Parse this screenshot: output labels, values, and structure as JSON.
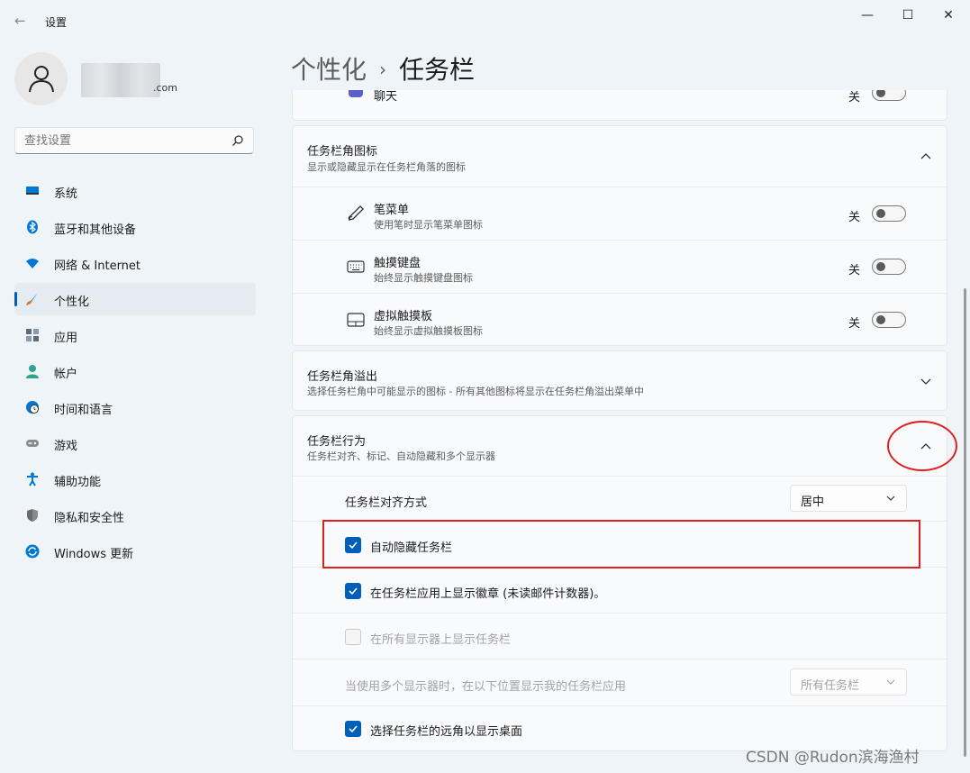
{
  "window": {
    "title": "设置",
    "back_icon": "arrow-left-icon",
    "minimize": "—",
    "maximize": "☐",
    "close": "✕"
  },
  "account": {
    "email_suffix": ".com",
    "avatar_icon": "person-icon"
  },
  "search": {
    "placeholder": "查找设置",
    "icon": "search-icon"
  },
  "nav": {
    "items": [
      {
        "label": "系统",
        "icon": "display-icon",
        "color": "#0078d4"
      },
      {
        "label": "蓝牙和其他设备",
        "icon": "bluetooth-icon",
        "color": "#0078d4"
      },
      {
        "label": "网络 & Internet",
        "icon": "wifi-icon",
        "color": "#0078d4"
      },
      {
        "label": "个性化",
        "icon": "brush-icon",
        "color": "#d07a2c",
        "active": true
      },
      {
        "label": "应用",
        "icon": "apps-icon",
        "color": "#5a6b7b"
      },
      {
        "label": "帐户",
        "icon": "account-icon",
        "color": "#2ca58d"
      },
      {
        "label": "时间和语言",
        "icon": "globe-clock-icon",
        "color": "#0078d4"
      },
      {
        "label": "游戏",
        "icon": "gamepad-icon",
        "color": "#6b6b6b"
      },
      {
        "label": "辅助功能",
        "icon": "accessibility-icon",
        "color": "#0078d4"
      },
      {
        "label": "隐私和安全性",
        "icon": "shield-icon",
        "color": "#6b6b6b"
      },
      {
        "label": "Windows 更新",
        "icon": "sync-icon",
        "color": "#0078d4"
      }
    ]
  },
  "breadcrumb": {
    "parent": "个性化",
    "separator": "›",
    "current": "任务栏"
  },
  "chat_row": {
    "label": "聊天",
    "toggle_state": "关"
  },
  "corner_icons": {
    "title": "任务栏角图标",
    "subtitle": "显示或隐藏显示在任务栏角落的图标",
    "expanded": true,
    "items": [
      {
        "title": "笔菜单",
        "desc": "使用笔时显示笔菜单图标",
        "state": "关",
        "icon": "pen-icon"
      },
      {
        "title": "触摸键盘",
        "desc": "始终显示触摸键盘图标",
        "state": "关",
        "icon": "keyboard-icon"
      },
      {
        "title": "虚拟触摸板",
        "desc": "始终显示虚拟触摸板图标",
        "state": "关",
        "icon": "touchpad-icon"
      }
    ]
  },
  "corner_overflow": {
    "title": "任务栏角溢出",
    "subtitle": "选择任务栏角中可能显示的图标 - 所有其他图标将显示在任务栏角溢出菜单中",
    "expanded": false
  },
  "behaviors": {
    "title": "任务栏行为",
    "subtitle": "任务栏对齐、标记、自动隐藏和多个显示器",
    "expanded": true,
    "alignment_label": "任务栏对齐方式",
    "alignment_value": "居中",
    "auto_hide_label": "自动隐藏任务栏",
    "auto_hide_checked": true,
    "badges_label": "在任务栏应用上显示徽章 (未读邮件计数器)。",
    "badges_checked": true,
    "all_displays_label": "在所有显示器上显示任务栏",
    "all_displays_checked": false,
    "multi_display_label": "当使用多个显示器时，在以下位置显示我的任务栏应用",
    "multi_display_value": "所有任务栏",
    "far_corner_label": "选择任务栏的远角以显示桌面",
    "far_corner_checked": true
  },
  "colors": {
    "accent": "#005fb8",
    "annotation": "#e02020"
  },
  "watermark": "CSDN @Rudon滨海渔村"
}
